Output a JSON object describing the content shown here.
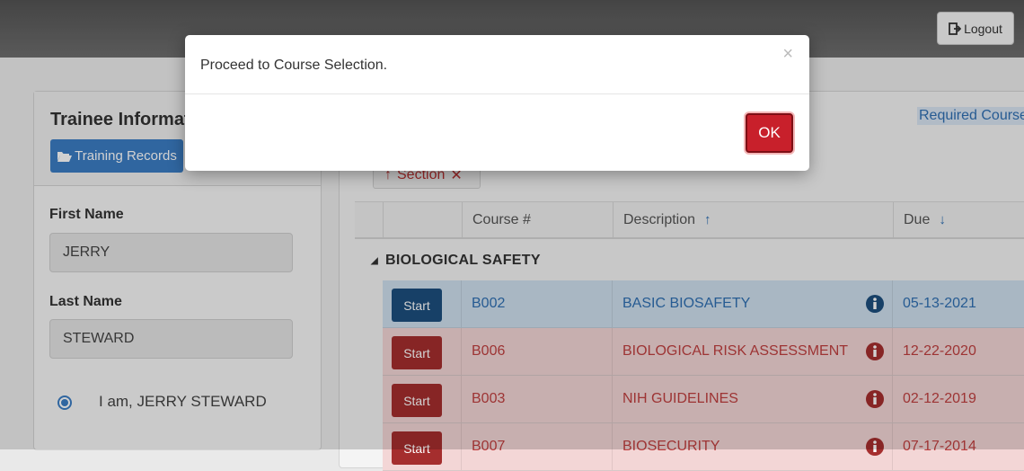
{
  "header": {
    "logout_label": "Logout"
  },
  "trainee": {
    "title": "Trainee Informat",
    "records_button": "Training Records",
    "first_name_label": "First Name",
    "first_name_value": "JERRY",
    "last_name_label": "Last Name",
    "last_name_value": "STEWARD",
    "confirm_label": "I am, JERRY STEWARD"
  },
  "courses": {
    "required_link": "Required Course",
    "section_chip": "Section",
    "columns": {
      "course": "Course #",
      "description": "Description",
      "due": "Due"
    },
    "group": "BIOLOGICAL SAFETY",
    "start_label": "Start",
    "rows": [
      {
        "course": "B002",
        "description": "BASIC BIOSAFETY",
        "due": "05-13-2021",
        "status": "current"
      },
      {
        "course": "B006",
        "description": "BIOLOGICAL RISK ASSESSMENT",
        "due": "12-22-2020",
        "status": "overdue"
      },
      {
        "course": "B003",
        "description": "NIH GUIDELINES",
        "due": "02-12-2019",
        "status": "overdue"
      },
      {
        "course": "B007",
        "description": "BIOSECURITY",
        "due": "07-17-2014",
        "status": "overdue"
      }
    ]
  },
  "modal": {
    "message": "Proceed to Course Selection.",
    "close_glyph": "×",
    "ok_label": "OK"
  },
  "colors": {
    "primary": "#3b7dc4",
    "danger": "#c8202b",
    "current_row": "#cfe0ee",
    "overdue_row": "#f3d6d6"
  }
}
